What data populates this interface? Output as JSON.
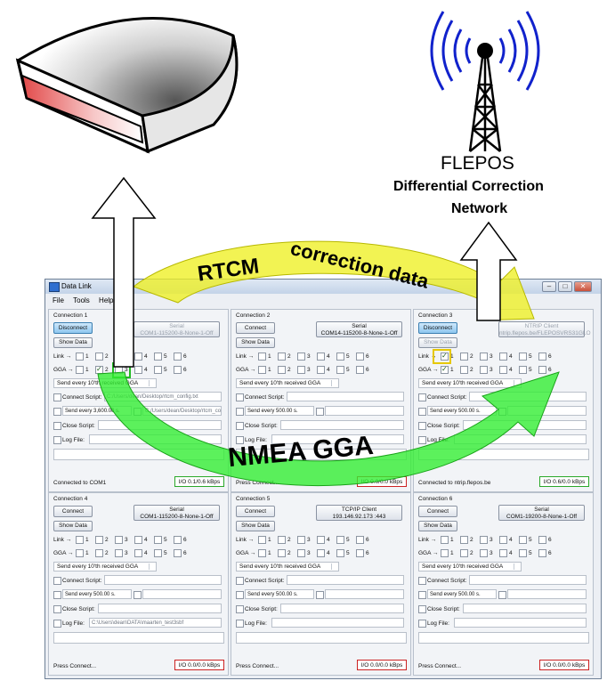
{
  "tower": {
    "title": "FLEPOS",
    "line1": "Differential Correction",
    "line2": "Network"
  },
  "arc_top": {
    "word1": "RTCM",
    "word2": "correction data"
  },
  "arc_bottom": {
    "text": "NMEA GGA"
  },
  "window": {
    "title": "Data Link",
    "menu": [
      {
        "label": "File"
      },
      {
        "label": "Tools"
      },
      {
        "label": "Help"
      }
    ],
    "controls": {
      "minimize": "–",
      "maximize": "□",
      "close": "✕"
    }
  },
  "common": {
    "link_label": "Link →",
    "gga_label": "GGA →",
    "connect_script": "Connect Script:",
    "close_script": "Close Script:",
    "log_file": "Log File:",
    "show_data": "Show Data",
    "nums": [
      "1",
      "2",
      "3",
      "4",
      "5",
      "6"
    ]
  },
  "panels": [
    {
      "title": "Connection 1",
      "button": "Disconnect",
      "type": "Serial",
      "param": "COM1-115200-8-None-1-Off",
      "gga": "Send every 10'th received GGA",
      "script_path": "C:/Users/dean/Desktop/rtcm_config.txt",
      "send_every": "Send every 3,600.00 s.",
      "send_path": "C:/Users/dean/Desktop/rtcm_config.txt",
      "log_path": "",
      "status": "Connected to COM1",
      "io": "I/O 0.1/0.6 kBps"
    },
    {
      "title": "Connection 2",
      "button": "Connect",
      "type": "Serial",
      "param": "COM14-115200-8-None-1-Off",
      "gga": "Send every 10'th received GGA",
      "script_path": "",
      "send_every": "Send every 500.00 s.",
      "send_path": "",
      "log_path": "",
      "status": "Press Connect...",
      "io": "I/O 0.0/0.0 kBps"
    },
    {
      "title": "Connection 3",
      "button": "Disconnect",
      "type": "NTRIP Client",
      "param": "ntrip.flepos.be/FLEPOSVRS31GLO",
      "gga": "Send every 10'th received GGA",
      "script_path": "",
      "send_every": "Send every 500.00 s.",
      "send_path": "",
      "log_path": "",
      "status": "Connected to ntrip.flepos.be",
      "io": "I/O 0.6/0.0 kBps"
    },
    {
      "title": "Connection 4",
      "button": "Connect",
      "type": "Serial",
      "param": "COM1-115200-8-None-1-Off",
      "gga": "Send every 10'th received GGA",
      "script_path": "",
      "send_every": "Send every 500.00 s.",
      "send_path": "",
      "log_path": "C:\\Users\\dean\\DATA\\maarten_test3sbf",
      "status": "Press Connect...",
      "io": "I/O 0.0/0.0 kBps"
    },
    {
      "title": "Connection 5",
      "button": "Connect",
      "type": "TCP/IP Client",
      "param": "193.146.92.173 :443",
      "gga": "Send every 10'th received GGA",
      "script_path": "",
      "send_every": "Send every 500.00 s.",
      "send_path": "",
      "log_path": "",
      "status": "Press Connect...",
      "io": "I/O 0.0/0.0 kBps"
    },
    {
      "title": "Connection 6",
      "button": "Connect",
      "type": "Serial",
      "param": "COM1-19200-8-None-1-Off",
      "gga": "Send every 10'th received GGA",
      "script_path": "",
      "send_every": "Send every 500.00 s.",
      "send_path": "",
      "log_path": "",
      "status": "Press Connect...",
      "io": "I/O 0.0/0.0 kBps"
    }
  ],
  "colors": {
    "arrow_green": "#33ee33",
    "arrow_yellow": "#eef022",
    "io_ok": "#2aa82a",
    "io_idle": "#cc2222",
    "tower_blue": "#1122cc"
  }
}
